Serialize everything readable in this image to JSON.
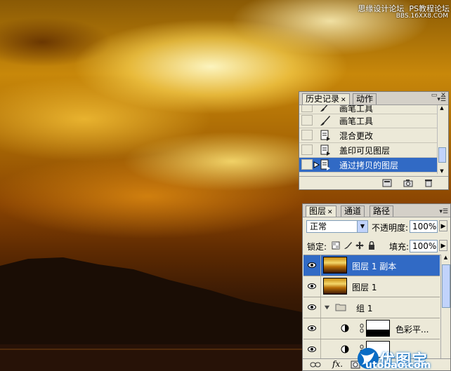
{
  "watermark": {
    "site_cn": "思缘设计论坛",
    "site_en": "PS教程论坛",
    "site_url": "BBS.16XX8.COM"
  },
  "history_panel": {
    "tabs": [
      {
        "label": "历史记录"
      },
      {
        "label": "动作"
      }
    ],
    "items": [
      {
        "label": "画笔工具",
        "icon": "brush-icon"
      },
      {
        "label": "画笔工具",
        "icon": "brush-icon"
      },
      {
        "label": "混合更改",
        "icon": "history-state-icon"
      },
      {
        "label": "盖印可见图层",
        "icon": "history-state-icon"
      },
      {
        "label": "通过拷贝的图层",
        "icon": "history-state-icon",
        "selected": true
      }
    ]
  },
  "layers_panel": {
    "tabs": [
      {
        "label": "图层"
      },
      {
        "label": "通道"
      },
      {
        "label": "路径"
      }
    ],
    "blend_mode": "正常",
    "opacity_label": "不透明度:",
    "opacity_value": "100%",
    "lock_label": "锁定:",
    "fill_label": "填充:",
    "fill_value": "100%",
    "layers": [
      {
        "name": "图层 1 副本",
        "selected": true
      },
      {
        "name": "图层 1"
      },
      {
        "name": "组 1",
        "type": "group"
      },
      {
        "name": "色彩平...",
        "type": "adjustment"
      }
    ],
    "fx_label": "fx."
  },
  "logo": {
    "cn": "优图宝",
    "en": "utobao.com"
  }
}
